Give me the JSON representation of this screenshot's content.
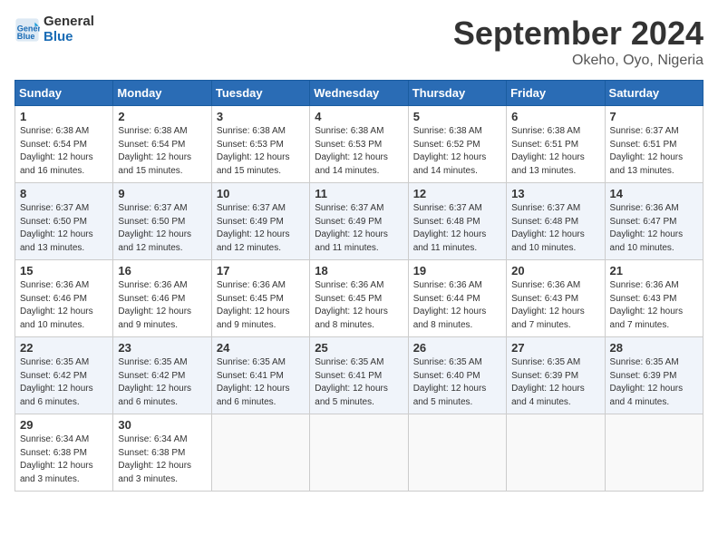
{
  "header": {
    "logo_line1": "General",
    "logo_line2": "Blue",
    "month_title": "September 2024",
    "location": "Okeho, Oyo, Nigeria"
  },
  "weekdays": [
    "Sunday",
    "Monday",
    "Tuesday",
    "Wednesday",
    "Thursday",
    "Friday",
    "Saturday"
  ],
  "weeks": [
    [
      {
        "day": "1",
        "info": "Sunrise: 6:38 AM\nSunset: 6:54 PM\nDaylight: 12 hours\nand 16 minutes."
      },
      {
        "day": "2",
        "info": "Sunrise: 6:38 AM\nSunset: 6:54 PM\nDaylight: 12 hours\nand 15 minutes."
      },
      {
        "day": "3",
        "info": "Sunrise: 6:38 AM\nSunset: 6:53 PM\nDaylight: 12 hours\nand 15 minutes."
      },
      {
        "day": "4",
        "info": "Sunrise: 6:38 AM\nSunset: 6:53 PM\nDaylight: 12 hours\nand 14 minutes."
      },
      {
        "day": "5",
        "info": "Sunrise: 6:38 AM\nSunset: 6:52 PM\nDaylight: 12 hours\nand 14 minutes."
      },
      {
        "day": "6",
        "info": "Sunrise: 6:38 AM\nSunset: 6:51 PM\nDaylight: 12 hours\nand 13 minutes."
      },
      {
        "day": "7",
        "info": "Sunrise: 6:37 AM\nSunset: 6:51 PM\nDaylight: 12 hours\nand 13 minutes."
      }
    ],
    [
      {
        "day": "8",
        "info": "Sunrise: 6:37 AM\nSunset: 6:50 PM\nDaylight: 12 hours\nand 13 minutes."
      },
      {
        "day": "9",
        "info": "Sunrise: 6:37 AM\nSunset: 6:50 PM\nDaylight: 12 hours\nand 12 minutes."
      },
      {
        "day": "10",
        "info": "Sunrise: 6:37 AM\nSunset: 6:49 PM\nDaylight: 12 hours\nand 12 minutes."
      },
      {
        "day": "11",
        "info": "Sunrise: 6:37 AM\nSunset: 6:49 PM\nDaylight: 12 hours\nand 11 minutes."
      },
      {
        "day": "12",
        "info": "Sunrise: 6:37 AM\nSunset: 6:48 PM\nDaylight: 12 hours\nand 11 minutes."
      },
      {
        "day": "13",
        "info": "Sunrise: 6:37 AM\nSunset: 6:48 PM\nDaylight: 12 hours\nand 10 minutes."
      },
      {
        "day": "14",
        "info": "Sunrise: 6:36 AM\nSunset: 6:47 PM\nDaylight: 12 hours\nand 10 minutes."
      }
    ],
    [
      {
        "day": "15",
        "info": "Sunrise: 6:36 AM\nSunset: 6:46 PM\nDaylight: 12 hours\nand 10 minutes."
      },
      {
        "day": "16",
        "info": "Sunrise: 6:36 AM\nSunset: 6:46 PM\nDaylight: 12 hours\nand 9 minutes."
      },
      {
        "day": "17",
        "info": "Sunrise: 6:36 AM\nSunset: 6:45 PM\nDaylight: 12 hours\nand 9 minutes."
      },
      {
        "day": "18",
        "info": "Sunrise: 6:36 AM\nSunset: 6:45 PM\nDaylight: 12 hours\nand 8 minutes."
      },
      {
        "day": "19",
        "info": "Sunrise: 6:36 AM\nSunset: 6:44 PM\nDaylight: 12 hours\nand 8 minutes."
      },
      {
        "day": "20",
        "info": "Sunrise: 6:36 AM\nSunset: 6:43 PM\nDaylight: 12 hours\nand 7 minutes."
      },
      {
        "day": "21",
        "info": "Sunrise: 6:36 AM\nSunset: 6:43 PM\nDaylight: 12 hours\nand 7 minutes."
      }
    ],
    [
      {
        "day": "22",
        "info": "Sunrise: 6:35 AM\nSunset: 6:42 PM\nDaylight: 12 hours\nand 6 minutes."
      },
      {
        "day": "23",
        "info": "Sunrise: 6:35 AM\nSunset: 6:42 PM\nDaylight: 12 hours\nand 6 minutes."
      },
      {
        "day": "24",
        "info": "Sunrise: 6:35 AM\nSunset: 6:41 PM\nDaylight: 12 hours\nand 6 minutes."
      },
      {
        "day": "25",
        "info": "Sunrise: 6:35 AM\nSunset: 6:41 PM\nDaylight: 12 hours\nand 5 minutes."
      },
      {
        "day": "26",
        "info": "Sunrise: 6:35 AM\nSunset: 6:40 PM\nDaylight: 12 hours\nand 5 minutes."
      },
      {
        "day": "27",
        "info": "Sunrise: 6:35 AM\nSunset: 6:39 PM\nDaylight: 12 hours\nand 4 minutes."
      },
      {
        "day": "28",
        "info": "Sunrise: 6:35 AM\nSunset: 6:39 PM\nDaylight: 12 hours\nand 4 minutes."
      }
    ],
    [
      {
        "day": "29",
        "info": "Sunrise: 6:34 AM\nSunset: 6:38 PM\nDaylight: 12 hours\nand 3 minutes."
      },
      {
        "day": "30",
        "info": "Sunrise: 6:34 AM\nSunset: 6:38 PM\nDaylight: 12 hours\nand 3 minutes."
      },
      {
        "day": "",
        "info": ""
      },
      {
        "day": "",
        "info": ""
      },
      {
        "day": "",
        "info": ""
      },
      {
        "day": "",
        "info": ""
      },
      {
        "day": "",
        "info": ""
      }
    ]
  ]
}
